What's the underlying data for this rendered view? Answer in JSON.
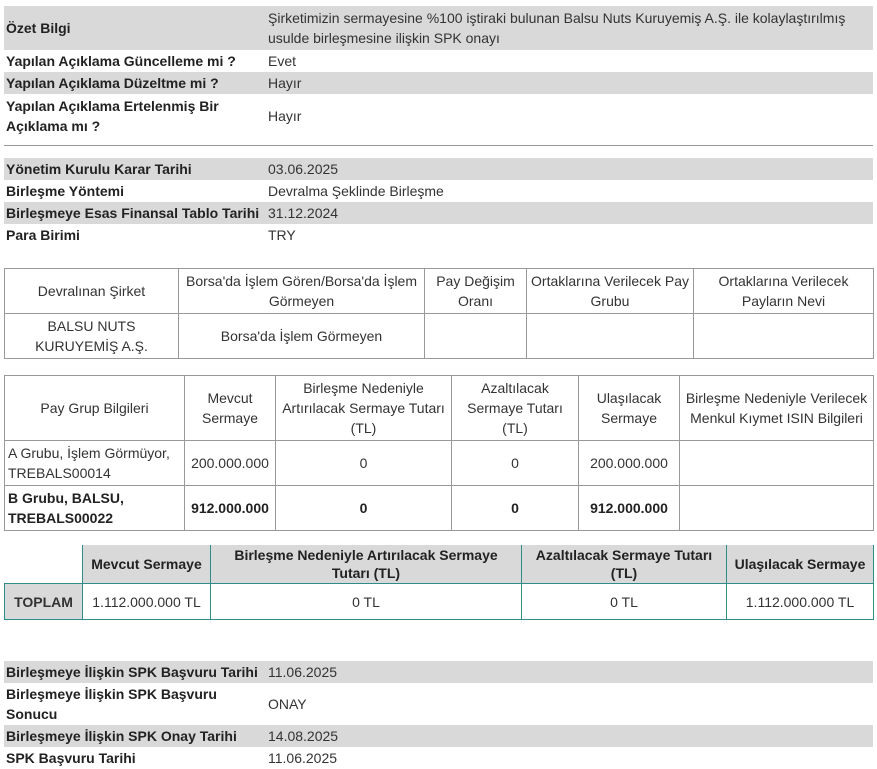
{
  "summary": [
    {
      "label": "Özet Bilgi",
      "value": "Şirketimizin sermayesine %100 iştiraki bulunan Balsu Nuts Kuruyemiş A.Ş. ile kolaylaştırılmış usulde birleşmesine ilişkin SPK onayı"
    },
    {
      "label": "Yapılan Açıklama Güncelleme mi ?",
      "value": "Evet"
    },
    {
      "label": "Yapılan Açıklama Düzeltme mi ?",
      "value": "Hayır"
    },
    {
      "label": "Yapılan Açıklama Ertelenmiş Bir Açıklama mı ?",
      "value": "Hayır"
    }
  ],
  "details": [
    {
      "label": "Yönetim Kurulu Karar Tarihi",
      "value": "03.06.2025"
    },
    {
      "label": "Birleşme Yöntemi",
      "value": "Devralma Şeklinde Birleşme"
    },
    {
      "label": "Birleşmeye Esas Finansal Tablo Tarihi",
      "value": "31.12.2024"
    },
    {
      "label": "Para Birimi",
      "value": "TRY"
    }
  ],
  "acquired_table": {
    "headers": [
      "Devralınan Şirket",
      "Borsa'da İşlem Gören/Borsa'da İşlem Görmeyen",
      "Pay Değişim Oranı",
      "Ortaklarına Verilecek Pay Grubu",
      "Ortaklarına Verilecek Payların Nevi"
    ],
    "row": [
      "BALSU NUTS KURUYEMİŞ A.Ş.",
      "Borsa'da İşlem Görmeyen",
      "",
      "",
      ""
    ]
  },
  "share_groups_table": {
    "headers": [
      "Pay Grup Bilgileri",
      "Mevcut Sermaye",
      "Birleşme Nedeniyle Artırılacak Sermaye Tutarı (TL)",
      "Azaltılacak Sermaye Tutarı (TL)",
      "Ulaşılacak Sermaye",
      "Birleşme Nedeniyle Verilecek Menkul Kıymet ISIN Bilgileri"
    ],
    "rows": [
      {
        "group": "A Grubu, İşlem Görmüyor, TREBALS00014",
        "current": "200.000.000",
        "increase": "0",
        "decrease": "0",
        "target": "200.000.000",
        "isin": ""
      },
      {
        "group": "B Grubu, BALSU, TREBALS00022",
        "current": "912.000.000",
        "increase": "0",
        "decrease": "0",
        "target": "912.000.000",
        "isin": ""
      }
    ]
  },
  "totals_table": {
    "headers": [
      "Mevcut Sermaye",
      "Birleşme Nedeniyle Artırılacak Sermaye Tutarı (TL)",
      "Azaltılacak Sermaye Tutarı (TL)",
      "Ulaşılacak Sermaye"
    ],
    "row_label": "TOPLAM",
    "values": [
      "1.112.000.000 TL",
      "0 TL",
      "0 TL",
      "1.112.000.000 TL"
    ]
  },
  "spk": [
    {
      "label": "Birleşmeye İlişkin SPK Başvuru Tarihi",
      "value": "11.06.2025"
    },
    {
      "label": "Birleşmeye İlişkin SPK Başvuru Sonucu",
      "value": "ONAY"
    },
    {
      "label": "Birleşmeye İlişkin SPK Onay Tarihi",
      "value": "14.08.2025"
    },
    {
      "label": "SPK Başvuru Tarihi",
      "value": "11.06.2025"
    }
  ]
}
